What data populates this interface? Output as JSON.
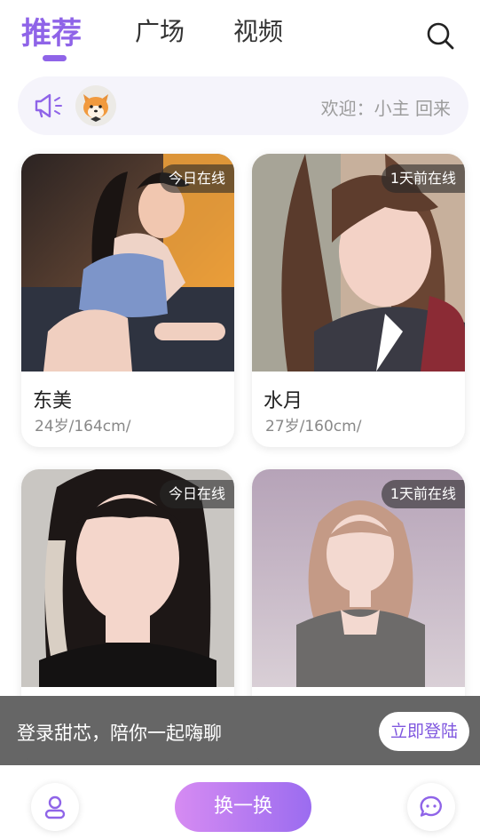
{
  "nav": {
    "tabs": [
      {
        "label": "推荐",
        "active": true
      },
      {
        "label": "广场",
        "active": false
      },
      {
        "label": "视频",
        "active": false
      }
    ],
    "search_icon": "search-icon",
    "accent_color": "#8f64e8"
  },
  "notice": {
    "icon": "megaphone-icon",
    "avatar": "fox-avatar",
    "text": "欢迎：小主 回来"
  },
  "profiles": [
    {
      "name": "东美",
      "info": "24岁/164cm/",
      "status": "今日在线"
    },
    {
      "name": "水月",
      "info": "27岁/160cm/",
      "status": "1天前在线"
    },
    {
      "name": "",
      "info": "",
      "status": "今日在线"
    },
    {
      "name": "",
      "info": "",
      "status": "1天前在线"
    }
  ],
  "login_banner": {
    "text": "登录甜芯，陪你一起嗨聊",
    "button": "立即登陆"
  },
  "bottom_bar": {
    "profile_icon": "user-icon",
    "swap_label": "换一换",
    "chat_icon": "chat-bubble-icon",
    "swap_gradient": [
      "#d68bf2",
      "#9b6cf0"
    ]
  }
}
